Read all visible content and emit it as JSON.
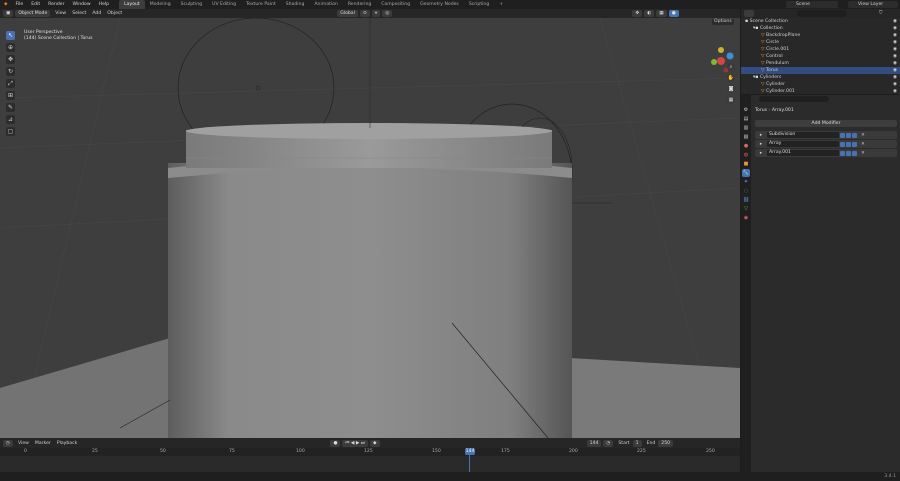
{
  "topbar": {
    "menus": [
      "File",
      "Edit",
      "Render",
      "Window",
      "Help"
    ],
    "workspaces": [
      "Layout",
      "Modeling",
      "Sculpting",
      "UV Editing",
      "Texture Paint",
      "Shading",
      "Animation",
      "Rendering",
      "Compositing",
      "Geometry Nodes",
      "Scripting"
    ],
    "scene": "Scene",
    "view_layer": "View Layer"
  },
  "viewport_header": {
    "mode": "Object Mode",
    "menus": [
      "View",
      "Select",
      "Add",
      "Object"
    ],
    "orientation": "Global",
    "options_label": "Options"
  },
  "viewport": {
    "perspective_label": "User Perspective",
    "collection_label": "(144) Scene Collection | Torus"
  },
  "outliner": {
    "search_placeholder": "",
    "items": [
      {
        "label": "Scene Collection"
      },
      {
        "label": "Collection"
      },
      {
        "label": "BackdropPlane"
      },
      {
        "label": "Circle"
      },
      {
        "label": "Circle.001"
      },
      {
        "label": "Control"
      },
      {
        "label": "Pendulum"
      },
      {
        "label": "Torus"
      },
      {
        "label": "Cylinders"
      },
      {
        "label": "Cylinder"
      },
      {
        "label": "Cylinder.001"
      }
    ],
    "selected": "Torus"
  },
  "properties": {
    "breadcrumb_object": "Torus",
    "breadcrumb_modifier": "Array.001",
    "add_modifier": "Add Modifier",
    "modifiers": [
      {
        "name": "Subdivision"
      },
      {
        "name": "Array"
      },
      {
        "name": "Array.001"
      }
    ]
  },
  "timeline": {
    "menus": [
      "View",
      "Marker",
      "Playback"
    ],
    "current_frame": "144",
    "start_label": "Start",
    "start_value": "1",
    "end_label": "End",
    "end_value": "250",
    "ruler": [
      "0",
      "25",
      "50",
      "75",
      "100",
      "125",
      "150",
      "175",
      "200",
      "225",
      "250"
    ],
    "playhead_label": "144"
  },
  "statusbar": {
    "version": "3.4.1"
  }
}
